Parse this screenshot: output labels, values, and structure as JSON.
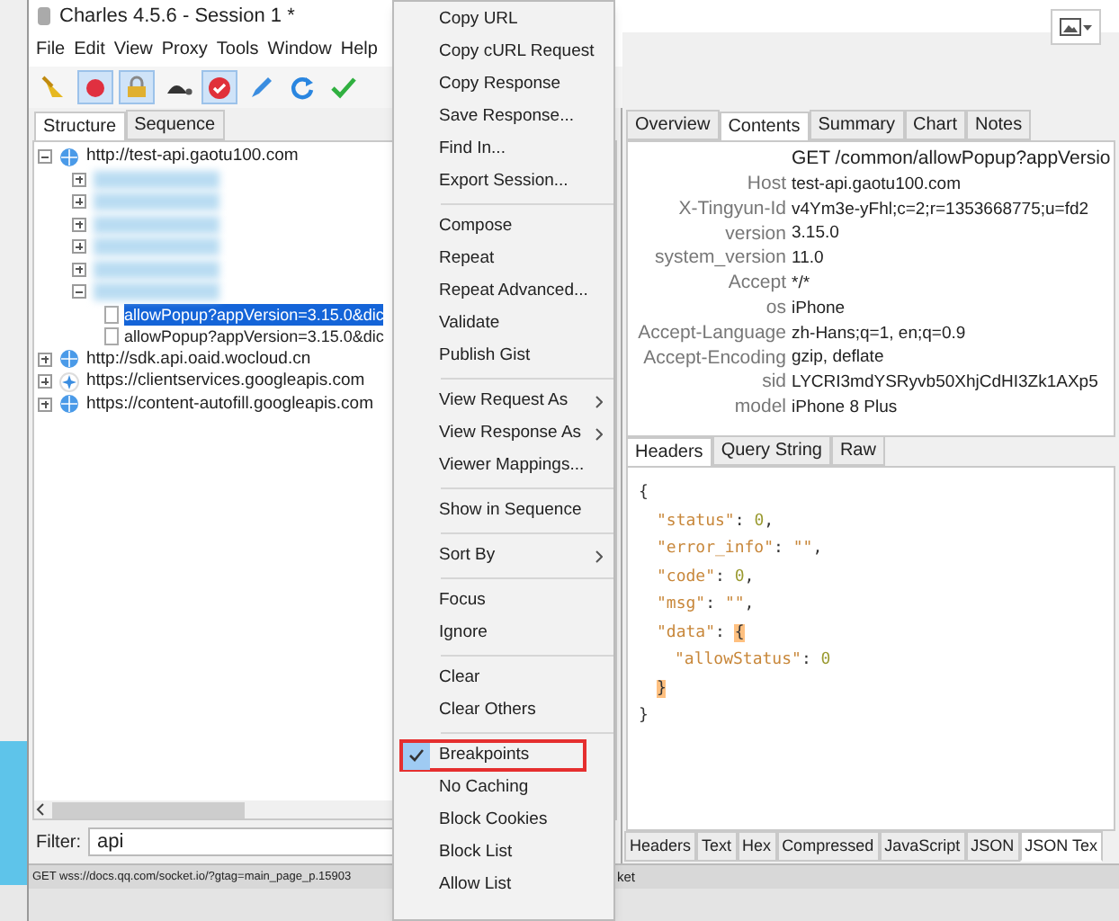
{
  "window": {
    "title": "Charles 4.5.6 - Session 1 *"
  },
  "menu_bar": [
    "File",
    "Edit",
    "View",
    "Proxy",
    "Tools",
    "Window",
    "Help"
  ],
  "toolbar": [
    {
      "kind": "broom",
      "on": false
    },
    {
      "kind": "record",
      "on": true
    },
    {
      "kind": "throttle",
      "on": true
    },
    {
      "kind": "turtle",
      "on": false
    },
    {
      "kind": "breakpoint",
      "on": true
    },
    {
      "kind": "pen",
      "on": false
    },
    {
      "kind": "refresh",
      "on": false
    },
    {
      "kind": "check",
      "on": false
    }
  ],
  "left_tabs": [
    {
      "label": "Structure",
      "selected": true
    },
    {
      "label": "Sequence",
      "selected": false
    }
  ],
  "tree": [
    {
      "kind": "host",
      "label": "http://test-api.gaotu100.com",
      "expanded": true,
      "children": [
        {
          "kind": "blurred",
          "expanded": false
        },
        {
          "kind": "blurred",
          "expanded": false
        },
        {
          "kind": "blurred",
          "expanded": false
        },
        {
          "kind": "blurred",
          "expanded": false
        },
        {
          "kind": "blurred",
          "expanded": false
        },
        {
          "kind": "blurred",
          "expanded": true,
          "children": [
            {
              "kind": "request",
              "label": "allowPopup?appVersion=3.15.0&dic",
              "selected": true
            },
            {
              "kind": "request",
              "label": "allowPopup?appVersion=3.15.0&dic",
              "selected": false
            }
          ]
        }
      ]
    },
    {
      "kind": "host",
      "label": "http://sdk.api.oaid.wocloud.cn",
      "expanded": false
    },
    {
      "kind": "service",
      "label": "https://clientservices.googleapis.com",
      "expanded": false
    },
    {
      "kind": "host",
      "label": "https://content-autofill.googleapis.com",
      "expanded": false
    }
  ],
  "filter": {
    "label": "Filter:",
    "value": "api"
  },
  "status_bar": {
    "text": "GET wss://docs.qq.com/socket.io/?gtag=main_page_p.15903",
    "tail": "ket"
  },
  "right_tabs": [
    {
      "label": "Overview",
      "selected": false
    },
    {
      "label": "Contents",
      "selected": true
    },
    {
      "label": "Summary",
      "selected": false
    },
    {
      "label": "Chart",
      "selected": false
    },
    {
      "label": "Notes",
      "selected": false
    }
  ],
  "request_line": "GET /common/allowPopup?appVersio",
  "headers": [
    {
      "name": "Host",
      "value": "test-api.gaotu100.com"
    },
    {
      "name": "X-Tingyun-Id",
      "value": "v4Ym3e-yFhl;c=2;r=1353668775;u=fd2"
    },
    {
      "name": "version",
      "value": "3.15.0"
    },
    {
      "name": "system_version",
      "value": "11.0"
    },
    {
      "name": "Accept",
      "value": "*/*"
    },
    {
      "name": "os",
      "value": "iPhone"
    },
    {
      "name": "Accept-Language",
      "value": "zh-Hans;q=1, en;q=0.9"
    },
    {
      "name": "Accept-Encoding",
      "value": "gzip, deflate"
    },
    {
      "name": "sid",
      "value": "LYCRI3mdYSRyvb50XhjCdHI3Zk1AXp5"
    },
    {
      "name": "model",
      "value": "iPhone 8 Plus"
    }
  ],
  "request_tabs": [
    {
      "label": "Headers",
      "selected": true
    },
    {
      "label": "Query String",
      "selected": false
    },
    {
      "label": "Raw",
      "selected": false
    }
  ],
  "json_lines": [
    [
      {
        "kind": "open",
        "text": "{"
      }
    ],
    [
      {
        "kind": "key",
        "text": "\"status\""
      },
      {
        "kind": "punct",
        "text": ": "
      },
      {
        "kind": "number",
        "text": "0"
      },
      {
        "kind": "punct",
        "text": ","
      }
    ],
    [
      {
        "kind": "key",
        "text": "\"error_info\""
      },
      {
        "kind": "punct",
        "text": ": "
      },
      {
        "kind": "string",
        "text": "\"\""
      },
      {
        "kind": "punct",
        "text": ","
      }
    ],
    [
      {
        "kind": "key",
        "text": "\"code\""
      },
      {
        "kind": "punct",
        "text": ": "
      },
      {
        "kind": "number",
        "text": "0"
      },
      {
        "kind": "punct",
        "text": ","
      }
    ],
    [
      {
        "kind": "key",
        "text": "\"msg\""
      },
      {
        "kind": "punct",
        "text": ": "
      },
      {
        "kind": "string",
        "text": "\"\""
      },
      {
        "kind": "punct",
        "text": ","
      }
    ],
    [
      {
        "kind": "key",
        "text": "\"data\""
      },
      {
        "kind": "punct",
        "text": ": "
      },
      {
        "kind": "open_match",
        "text": "{"
      }
    ],
    [
      {
        "kind": "key",
        "text": "\"allowStatus\""
      },
      {
        "kind": "punct",
        "text": ": "
      },
      {
        "kind": "number",
        "text": "0"
      }
    ],
    [
      {
        "kind": "close_match",
        "text": "}"
      }
    ],
    [
      {
        "kind": "close",
        "text": "}"
      }
    ]
  ],
  "response_tabs": [
    {
      "label": "Headers",
      "selected": false
    },
    {
      "label": "Text",
      "selected": false
    },
    {
      "label": "Hex",
      "selected": false
    },
    {
      "label": "Compressed",
      "selected": false
    },
    {
      "label": "JavaScript",
      "selected": false
    },
    {
      "label": "JSON",
      "selected": false
    },
    {
      "label": "JSON Tex",
      "selected": true
    }
  ],
  "context_menu": [
    [
      {
        "label": "Copy URL",
        "highlighted": false
      },
      {
        "label": "Copy cURL Request",
        "highlighted": false
      },
      {
        "label": "Copy Response",
        "highlighted": false
      },
      {
        "label": "Save Response...",
        "highlighted": false
      },
      {
        "label": "Find In...",
        "highlighted": false
      },
      {
        "label": "Export Session...",
        "highlighted": false
      }
    ],
    [
      {
        "label": "Compose",
        "highlighted": false
      },
      {
        "label": "Repeat",
        "highlighted": false
      },
      {
        "label": "Repeat Advanced...",
        "highlighted": false
      },
      {
        "label": "Validate",
        "highlighted": false
      },
      {
        "label": "Publish Gist",
        "highlighted": false
      }
    ],
    [
      {
        "label": "View Request As",
        "submenu": true,
        "highlighted": false
      },
      {
        "label": "View Response As",
        "submenu": true,
        "highlighted": false
      },
      {
        "label": "Viewer Mappings...",
        "highlighted": false
      }
    ],
    [
      {
        "label": "Show in Sequence",
        "highlighted": false
      }
    ],
    [
      {
        "label": "Sort By",
        "submenu": true,
        "highlighted": false
      }
    ],
    [
      {
        "label": "Focus",
        "highlighted": false
      },
      {
        "label": "Ignore",
        "highlighted": false
      }
    ],
    [
      {
        "label": "Clear",
        "highlighted": false
      },
      {
        "label": "Clear Others",
        "highlighted": false
      }
    ],
    [
      {
        "label": "Breakpoints",
        "checked": true,
        "highlighted": true
      },
      {
        "label": "No Caching",
        "checked": false,
        "highlighted": false
      },
      {
        "label": "Block Cookies",
        "checked": false,
        "highlighted": false
      },
      {
        "label": "Block List",
        "checked": false,
        "highlighted": false
      },
      {
        "label": "Allow List",
        "checked": false,
        "highlighted": false
      }
    ]
  ]
}
